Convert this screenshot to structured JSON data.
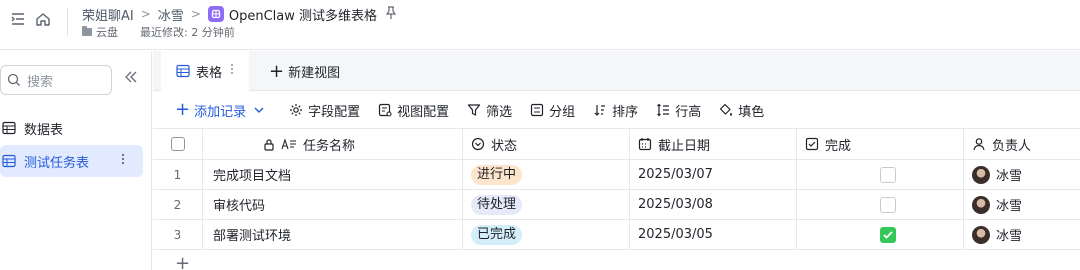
{
  "header": {
    "breadcrumb_root": "荣姐聊AI",
    "breadcrumb_folder": "冰雪",
    "doc_title": "OpenClaw 测试多维表格",
    "location": "云盘",
    "last_modified": "最近修改: 2 分钟前",
    "doc_icon_color": "#8d6cf6"
  },
  "sidebar": {
    "search_placeholder": "搜索",
    "items": [
      {
        "label": "数据表"
      },
      {
        "label": "测试任务表"
      }
    ]
  },
  "tabs": {
    "active": "表格",
    "new_view": "新建视图"
  },
  "toolbar": {
    "add_record": "添加记录",
    "field_config": "字段配置",
    "view_config": "视图配置",
    "filter": "筛选",
    "group": "分组",
    "sort": "排序",
    "row_height": "行高",
    "fill_color": "填色"
  },
  "table": {
    "columns": [
      "任务名称",
      "状态",
      "截止日期",
      "完成",
      "负责人"
    ],
    "rows": [
      {
        "num": "1",
        "name": "完成项目文档",
        "status": "进行中",
        "due": "2025/03/07",
        "done": false,
        "owner": "冰雪"
      },
      {
        "num": "2",
        "name": "审核代码",
        "status": "待处理",
        "due": "2025/03/08",
        "done": false,
        "owner": "冰雪"
      },
      {
        "num": "3",
        "name": "部署测试环境",
        "status": "已完成",
        "due": "2025/03/05",
        "done": true,
        "owner": "冰雪"
      }
    ]
  },
  "colors": {
    "accent": "#245bdb",
    "status_in_progress_bg": "#fde5cc",
    "status_pending_bg": "#e6e9f8",
    "status_done_bg": "#d4eefa",
    "done_check": "#34c759"
  }
}
